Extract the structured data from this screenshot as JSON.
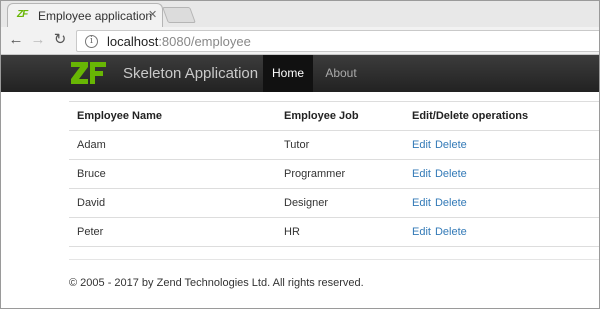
{
  "browser": {
    "tab_title": "Employee application",
    "url_host": "localhost",
    "url_rest": ":8080/employee"
  },
  "app": {
    "brand": "Skeleton Application",
    "nav": [
      {
        "label": "Home",
        "active": true
      },
      {
        "label": "About",
        "active": false
      }
    ]
  },
  "table": {
    "headers": [
      "Employee Name",
      "Employee Job",
      "Edit/Delete operations"
    ],
    "rows": [
      {
        "name": "Adam",
        "job": "Tutor",
        "edit": "Edit",
        "delete": "Delete"
      },
      {
        "name": "Bruce",
        "job": "Programmer",
        "edit": "Edit",
        "delete": "Delete"
      },
      {
        "name": "David",
        "job": "Designer",
        "edit": "Edit",
        "delete": "Delete"
      },
      {
        "name": "Peter",
        "job": "HR",
        "edit": "Edit",
        "delete": "Delete"
      }
    ]
  },
  "footer": "© 2005 - 2017 by Zend Technologies Ltd. All rights reserved.",
  "colors": {
    "link": "#337ab7",
    "logo_green": "#68b604",
    "navbar": "#222222"
  },
  "icons": [
    "zf-favicon",
    "close-icon",
    "back-arrow-icon",
    "forward-arrow-icon",
    "reload-icon",
    "info-icon",
    "zf-logo"
  ]
}
